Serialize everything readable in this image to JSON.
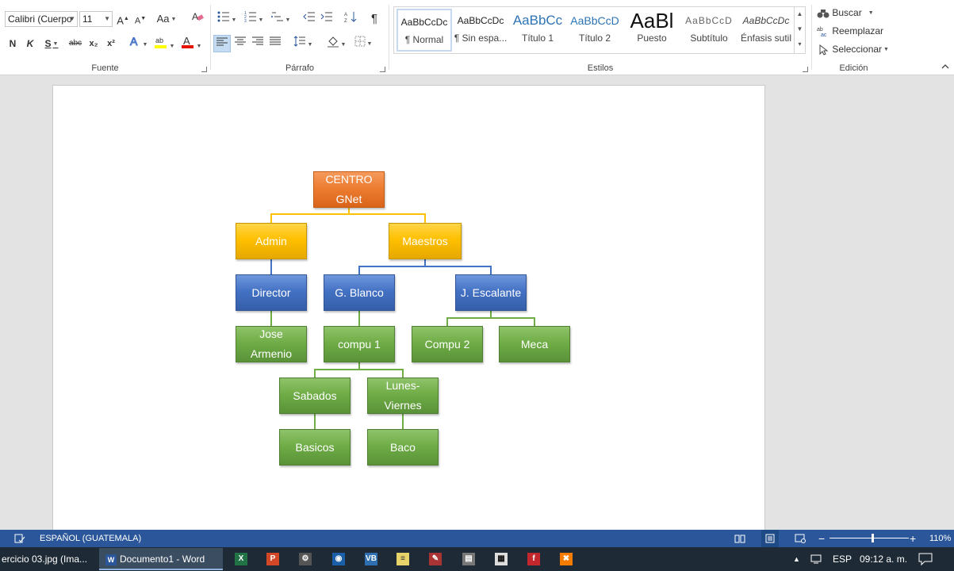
{
  "ribbon": {
    "font": {
      "label": "Fuente",
      "font_name": "Calibri (Cuerpo",
      "font_size": "11",
      "change_case": "Aa",
      "bold": "N",
      "italic": "K",
      "underline": "S",
      "strikethrough": "abc",
      "subscript": "x₂",
      "superscript": "x²"
    },
    "paragraph": {
      "label": "Párrafo",
      "pilcrow": "¶"
    },
    "styles": {
      "label": "Estilos",
      "items": [
        {
          "preview": "AaBbCcDc",
          "name": "¶ Normal"
        },
        {
          "preview": "AaBbCcDc",
          "name": "¶ Sin espa..."
        },
        {
          "preview": "AaBbCc",
          "name": "Título 1"
        },
        {
          "preview": "AaBbCcD",
          "name": "Título 2"
        },
        {
          "preview": "AaBl",
          "name": "Puesto"
        },
        {
          "preview": "AaBbCcD",
          "name": "Subtítulo"
        },
        {
          "preview": "AaBbCcDc",
          "name": "Énfasis sutil"
        }
      ]
    },
    "editing": {
      "label": "Edición",
      "find": "Buscar",
      "replace": "Reemplazar",
      "select": "Seleccionar"
    }
  },
  "orgchart": {
    "nodes": {
      "centro": "CENTRO GNet",
      "admin": "Admin",
      "maestros": "Maestros",
      "director": "Director",
      "gblanco": "G. Blanco",
      "jescalante": "J. Escalante",
      "jose": "Jose Armenio",
      "compu1": "compu 1",
      "compu2": "Compu 2",
      "meca": "Meca",
      "sabados": "Sabados",
      "lunes": "Lunes-Viernes",
      "basicos": "Basicos",
      "baco": "Baco"
    }
  },
  "statusbar": {
    "language": "ESPAÑOL (GUATEMALA)",
    "zoom": "110%",
    "zoom_level": 0.55
  },
  "taskbar": {
    "items": [
      {
        "label": "ercicio 03.jpg (Ima..."
      },
      {
        "label": "Documento1 - Word"
      }
    ],
    "lang": "ESP",
    "time": "09:12 a. m."
  },
  "colors": {
    "orange": "#ed7d31",
    "yellow": "#ffc000",
    "blue": "#4472c4",
    "green": "#70ad47",
    "statusbar": "#2b579a"
  }
}
